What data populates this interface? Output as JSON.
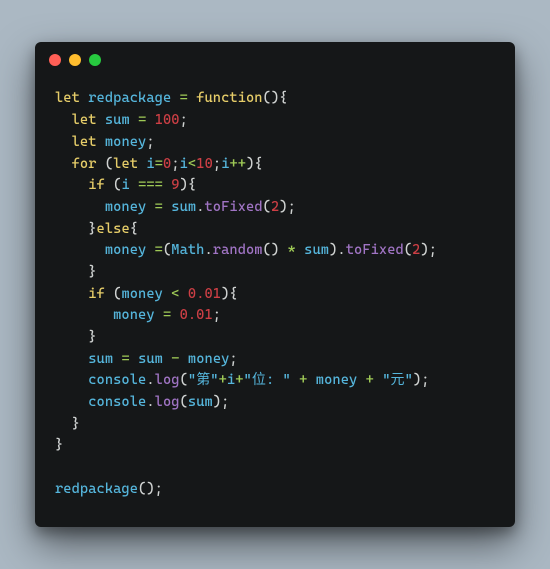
{
  "traffic_lights": [
    "red",
    "yellow",
    "green"
  ],
  "code": {
    "t": {
      "let": "let",
      "function": "function",
      "for": "for",
      "if": "if",
      "else": "else",
      "redpackage": "redpackage",
      "sum": "sum",
      "money": "money",
      "i": "i",
      "Math": "Math",
      "random": "random",
      "toFixed": "toFixed",
      "console": "console",
      "log": "log",
      "n100": "100",
      "n0": "0",
      "n10": "10",
      "n9": "9",
      "n2": "2",
      "n001": "0.01",
      "s1": "\"第\"",
      "s2": "\"位: \"",
      "s3": "\"元\"",
      "eq": " = ",
      "tripleEq": " === ",
      "plusplus": "++",
      "lt": "<",
      "minus": " - ",
      "plus": " + ",
      "times": " * ",
      "op": "(",
      "cp": ")",
      "ob": "{",
      "cb": "}",
      "sc": ";",
      "dot": ".",
      "comma": ","
    }
  }
}
